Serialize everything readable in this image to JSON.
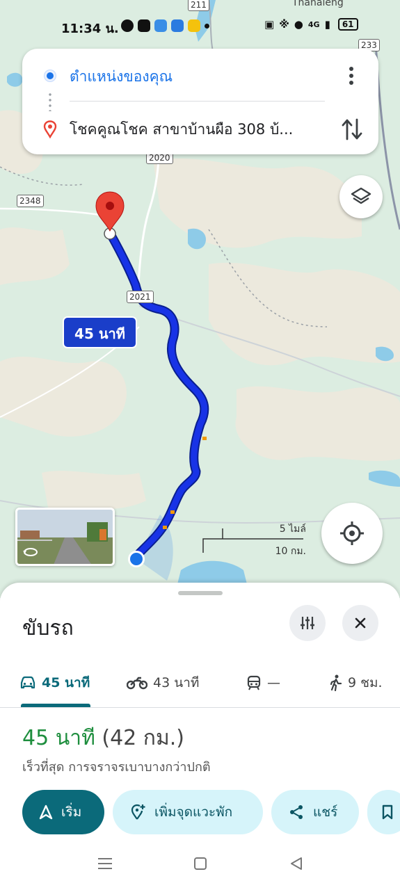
{
  "status_bar": {
    "time": "11:34 น.",
    "battery": "61",
    "network": "4G"
  },
  "directions": {
    "origin": "ตำแหน่งของคุณ",
    "destination": "โชคคูณโชค สาขาบ้านผือ 308 บ้..."
  },
  "map": {
    "route_time_label": "45 นาที",
    "place_labels": [
      "Thanaleng"
    ],
    "road_shields": [
      "211",
      "233",
      "2020",
      "2348",
      "2021"
    ],
    "scale_miles": "5 ไมล์",
    "scale_km": "10 กม.",
    "route_color": "#1a3ec9"
  },
  "sheet": {
    "mode_title": "ขับรถ",
    "tabs": [
      {
        "label": "45 นาที",
        "icon": "car-icon",
        "active": true
      },
      {
        "label": "43 นาที",
        "icon": "motorcycle-icon",
        "active": false
      },
      {
        "label": "—",
        "icon": "train-icon",
        "active": false
      },
      {
        "label": "9 ชม.",
        "icon": "walk-icon",
        "active": false
      }
    ],
    "summary_duration": "45 นาที",
    "summary_distance": "(42 กม.)",
    "summary_desc": "เร็วที่สุด การจราจรเบาบางกว่าปกติ",
    "actions": {
      "start": "เริ่ม",
      "add_stop": "เพิ่มจุดแวะพัก",
      "share": "แชร์"
    }
  },
  "colors": {
    "accent_teal": "#0b6a7a",
    "green": "#1e8e3e",
    "blue": "#1a73e8"
  }
}
